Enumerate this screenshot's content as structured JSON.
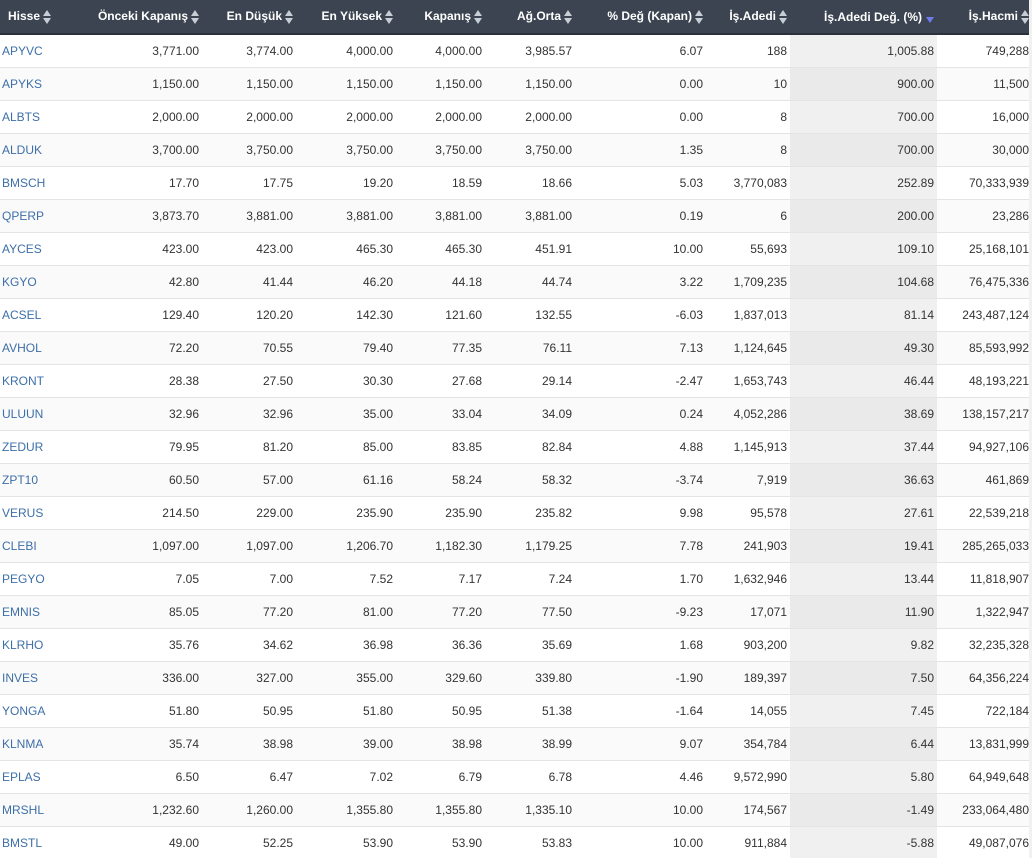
{
  "table": {
    "headers": [
      {
        "label": "Hisse",
        "sort": "both"
      },
      {
        "label": "Önceki Kapanış",
        "sort": "both"
      },
      {
        "label": "En Düşük",
        "sort": "both"
      },
      {
        "label": "En Yüksek",
        "sort": "both"
      },
      {
        "label": "Kapanış",
        "sort": "both"
      },
      {
        "label": "Ağ.Orta",
        "sort": "both"
      },
      {
        "label": "% Değ (Kapan)",
        "sort": "both"
      },
      {
        "label": "İş.Adedi",
        "sort": "both"
      },
      {
        "label": "İş.Adedi Değ. (%)",
        "sort": "desc"
      },
      {
        "label": "İş.Hacmi",
        "sort": "both"
      }
    ],
    "sorted_column": 8,
    "sort_indicator_color": "#6f7cf0",
    "rows": [
      [
        "APYVC",
        "3,771.00",
        "3,774.00",
        "4,000.00",
        "4,000.00",
        "3,985.57",
        "6.07",
        "188",
        "1,005.88",
        "749,288"
      ],
      [
        "APYKS",
        "1,150.00",
        "1,150.00",
        "1,150.00",
        "1,150.00",
        "1,150.00",
        "0.00",
        "10",
        "900.00",
        "11,500"
      ],
      [
        "ALBTS",
        "2,000.00",
        "2,000.00",
        "2,000.00",
        "2,000.00",
        "2,000.00",
        "0.00",
        "8",
        "700.00",
        "16,000"
      ],
      [
        "ALDUK",
        "3,700.00",
        "3,750.00",
        "3,750.00",
        "3,750.00",
        "3,750.00",
        "1.35",
        "8",
        "700.00",
        "30,000"
      ],
      [
        "BMSCH",
        "17.70",
        "17.75",
        "19.20",
        "18.59",
        "18.66",
        "5.03",
        "3,770,083",
        "252.89",
        "70,333,939"
      ],
      [
        "QPERP",
        "3,873.70",
        "3,881.00",
        "3,881.00",
        "3,881.00",
        "3,881.00",
        "0.19",
        "6",
        "200.00",
        "23,286"
      ],
      [
        "AYCES",
        "423.00",
        "423.00",
        "465.30",
        "465.30",
        "451.91",
        "10.00",
        "55,693",
        "109.10",
        "25,168,101"
      ],
      [
        "KGYO",
        "42.80",
        "41.44",
        "46.20",
        "44.18",
        "44.74",
        "3.22",
        "1,709,235",
        "104.68",
        "76,475,336"
      ],
      [
        "ACSEL",
        "129.40",
        "120.20",
        "142.30",
        "121.60",
        "132.55",
        "-6.03",
        "1,837,013",
        "81.14",
        "243,487,124"
      ],
      [
        "AVHOL",
        "72.20",
        "70.55",
        "79.40",
        "77.35",
        "76.11",
        "7.13",
        "1,124,645",
        "49.30",
        "85,593,992"
      ],
      [
        "KRONT",
        "28.38",
        "27.50",
        "30.30",
        "27.68",
        "29.14",
        "-2.47",
        "1,653,743",
        "46.44",
        "48,193,221"
      ],
      [
        "ULUUN",
        "32.96",
        "32.96",
        "35.00",
        "33.04",
        "34.09",
        "0.24",
        "4,052,286",
        "38.69",
        "138,157,217"
      ],
      [
        "ZEDUR",
        "79.95",
        "81.20",
        "85.00",
        "83.85",
        "82.84",
        "4.88",
        "1,145,913",
        "37.44",
        "94,927,106"
      ],
      [
        "ZPT10",
        "60.50",
        "57.00",
        "61.16",
        "58.24",
        "58.32",
        "-3.74",
        "7,919",
        "36.63",
        "461,869"
      ],
      [
        "VERUS",
        "214.50",
        "229.00",
        "235.90",
        "235.90",
        "235.82",
        "9.98",
        "95,578",
        "27.61",
        "22,539,218"
      ],
      [
        "CLEBI",
        "1,097.00",
        "1,097.00",
        "1,206.70",
        "1,182.30",
        "1,179.25",
        "7.78",
        "241,903",
        "19.41",
        "285,265,033"
      ],
      [
        "PEGYO",
        "7.05",
        "7.00",
        "7.52",
        "7.17",
        "7.24",
        "1.70",
        "1,632,946",
        "13.44",
        "11,818,907"
      ],
      [
        "EMNIS",
        "85.05",
        "77.20",
        "81.00",
        "77.20",
        "77.50",
        "-9.23",
        "17,071",
        "11.90",
        "1,322,947"
      ],
      [
        "KLRHO",
        "35.76",
        "34.62",
        "36.98",
        "36.36",
        "35.69",
        "1.68",
        "903,200",
        "9.82",
        "32,235,328"
      ],
      [
        "INVES",
        "336.00",
        "327.00",
        "355.00",
        "329.60",
        "339.80",
        "-1.90",
        "189,397",
        "7.50",
        "64,356,224"
      ],
      [
        "YONGA",
        "51.80",
        "50.95",
        "51.80",
        "50.95",
        "51.38",
        "-1.64",
        "14,055",
        "7.45",
        "722,184"
      ],
      [
        "KLNMA",
        "35.74",
        "38.98",
        "39.00",
        "38.98",
        "38.99",
        "9.07",
        "354,784",
        "6.44",
        "13,831,999"
      ],
      [
        "EPLAS",
        "6.50",
        "6.47",
        "7.02",
        "6.79",
        "6.78",
        "4.46",
        "9,572,990",
        "5.80",
        "64,949,648"
      ],
      [
        "MRSHL",
        "1,232.60",
        "1,260.00",
        "1,355.80",
        "1,355.80",
        "1,335.10",
        "10.00",
        "174,567",
        "-1.49",
        "233,064,480"
      ],
      [
        "BMSTL",
        "49.00",
        "52.25",
        "53.90",
        "53.90",
        "53.83",
        "10.00",
        "911,884",
        "-5.88",
        "49,087,076"
      ]
    ]
  }
}
